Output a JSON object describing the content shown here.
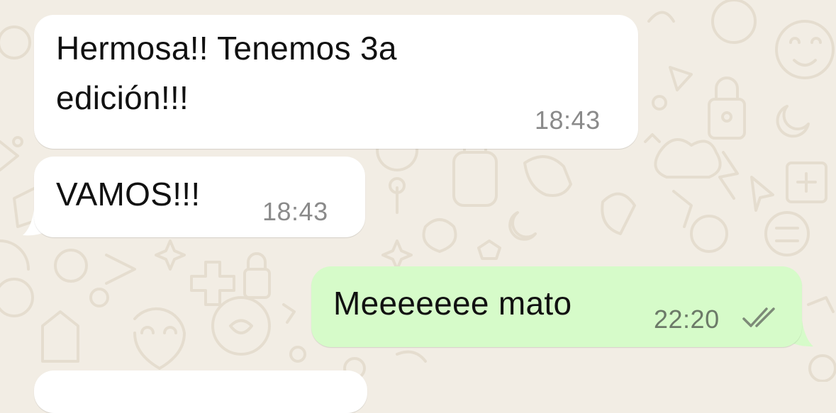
{
  "chat": {
    "messages": [
      {
        "direction": "incoming",
        "text": "Hermosa!! Tenemos 3a\nedición!!!",
        "time": "18:43"
      },
      {
        "direction": "incoming",
        "text": "VAMOS!!!",
        "time": "18:43"
      },
      {
        "direction": "outgoing",
        "text": "Meeeeeee mato",
        "time": "22:20",
        "status_icon": "double-check-read-icon"
      }
    ]
  },
  "colors": {
    "background": "#f2ede4",
    "incoming_bubble": "#ffffff",
    "outgoing_bubble": "#d6fbc9",
    "wallpaper_doodle": "#e5ddcf",
    "timestamp": "#8a8a8a"
  }
}
